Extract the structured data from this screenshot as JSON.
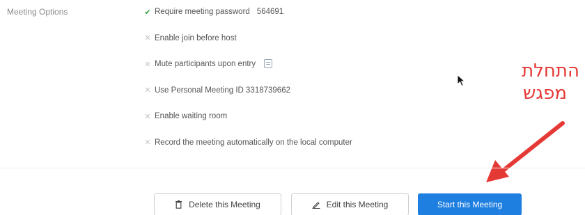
{
  "section": {
    "label": "Meeting Options"
  },
  "options": [
    {
      "label": "Require meeting password",
      "enabled": true,
      "extra": "564691",
      "icon": "check-icon"
    },
    {
      "label": "Enable join before host",
      "enabled": false,
      "icon": "x-icon"
    },
    {
      "label": "Mute participants upon entry",
      "enabled": false,
      "icon": "x-icon",
      "info_icon": "info-icon"
    },
    {
      "label": "Use Personal Meeting ID 3318739662",
      "enabled": false,
      "icon": "x-icon"
    },
    {
      "label": "Enable waiting room",
      "enabled": false,
      "icon": "x-icon"
    },
    {
      "label": "Record the meeting automatically on the local computer",
      "enabled": false,
      "icon": "x-icon"
    }
  ],
  "annotation": {
    "line1": "התחלת",
    "line2": "מפגש",
    "color": "#e53935"
  },
  "buttons": {
    "delete": {
      "label": "Delete this Meeting",
      "icon": "trash-icon"
    },
    "edit": {
      "label": "Edit this Meeting",
      "icon": "pencil-icon"
    },
    "start": {
      "label": "Start this Meeting"
    }
  },
  "colors": {
    "primary": "#1e7fe0",
    "check": "#2e9b3e",
    "annotation": "#e53935"
  }
}
